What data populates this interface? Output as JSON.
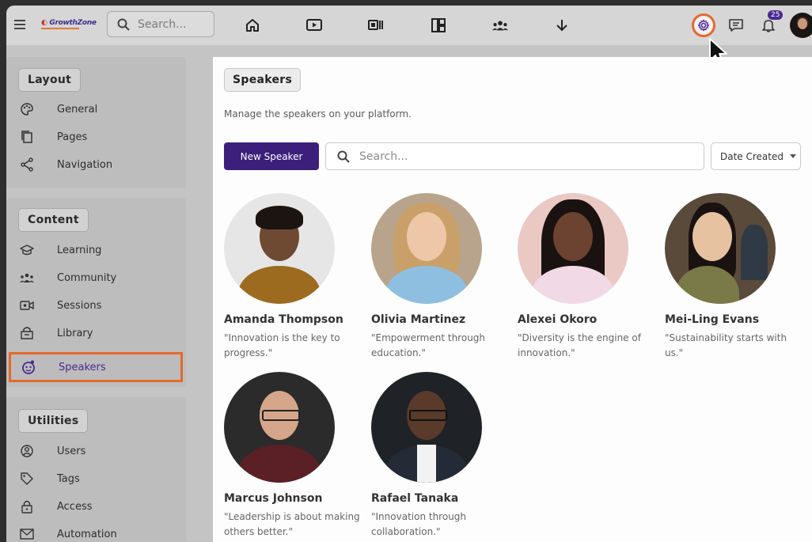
{
  "topbar": {
    "logo_text": "GrowthZone",
    "search_placeholder": "Search...",
    "notification_count": "25"
  },
  "icons": {
    "menu": "hamburger-icon",
    "home": "home-icon",
    "sessions": "play-icon",
    "library": "library-icon",
    "layout": "layout-icon",
    "community": "people-icon",
    "download": "arrow-down-icon",
    "settings": "gear-icon",
    "messages": "chat-icon",
    "notifications": "bell-icon"
  },
  "sidebar": {
    "layout_title": "Layout",
    "layout_items": [
      {
        "label": "General",
        "icon": "palette-icon"
      },
      {
        "label": "Pages",
        "icon": "pages-icon"
      },
      {
        "label": "Navigation",
        "icon": "share-icon"
      }
    ],
    "content_title": "Content",
    "content_items": [
      {
        "label": "Learning",
        "icon": "graduation-cap-icon"
      },
      {
        "label": "Community",
        "icon": "people-icon"
      },
      {
        "label": "Sessions",
        "icon": "video-icon"
      },
      {
        "label": "Library",
        "icon": "box-icon"
      },
      {
        "label": "Speakers",
        "icon": "speaker-icon",
        "active": true
      }
    ],
    "utilities_title": "Utilities",
    "utilities_items": [
      {
        "label": "Users",
        "icon": "users-icon"
      },
      {
        "label": "Tags",
        "icon": "tag-icon"
      },
      {
        "label": "Access",
        "icon": "lock-icon"
      },
      {
        "label": "Automation",
        "icon": "mail-icon"
      }
    ]
  },
  "main": {
    "title": "Speakers",
    "subtitle": "Manage the speakers on your platform.",
    "new_button": "New Speaker",
    "search_placeholder": "Search...",
    "sort_label": "Date Created"
  },
  "speakers": [
    {
      "name": "Amanda Thompson",
      "quote": "\"Innovation is the key to progress.\""
    },
    {
      "name": "Olivia Martinez",
      "quote": "\"Empowerment through education.\""
    },
    {
      "name": "Alexei Okoro",
      "quote": "\"Diversity is the engine of innovation.\""
    },
    {
      "name": "Mei-Ling Evans",
      "quote": "\"Sustainability starts with us.\""
    },
    {
      "name": "Marcus Johnson",
      "quote": "\"Leadership is about making others better.\""
    },
    {
      "name": "Rafael Tanaka",
      "quote": "\"Innovation through collaboration.\""
    }
  ]
}
